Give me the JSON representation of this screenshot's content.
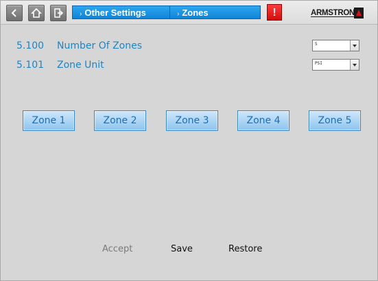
{
  "breadcrumbs": [
    "Other Settings",
    "Zones"
  ],
  "alarm_label": "!",
  "logo_text": "ARMSTRONG",
  "parameters": [
    {
      "id": "5.100",
      "name": "Number Of Zones",
      "value": "5"
    },
    {
      "id": "5.101",
      "name": "Zone Unit",
      "value": "PSI"
    }
  ],
  "zones": [
    "Zone 1",
    "Zone 2",
    "Zone 3",
    "Zone 4",
    "Zone 5"
  ],
  "actions": {
    "accept": "Accept",
    "save": "Save",
    "restore": "Restore"
  },
  "colors": {
    "accent": "#1b86c6",
    "breadcrumb_bg": "#1a93e3",
    "alarm": "#e01b1b",
    "background": "#d6d6d6",
    "disabled_text": "#7a7a7a"
  }
}
